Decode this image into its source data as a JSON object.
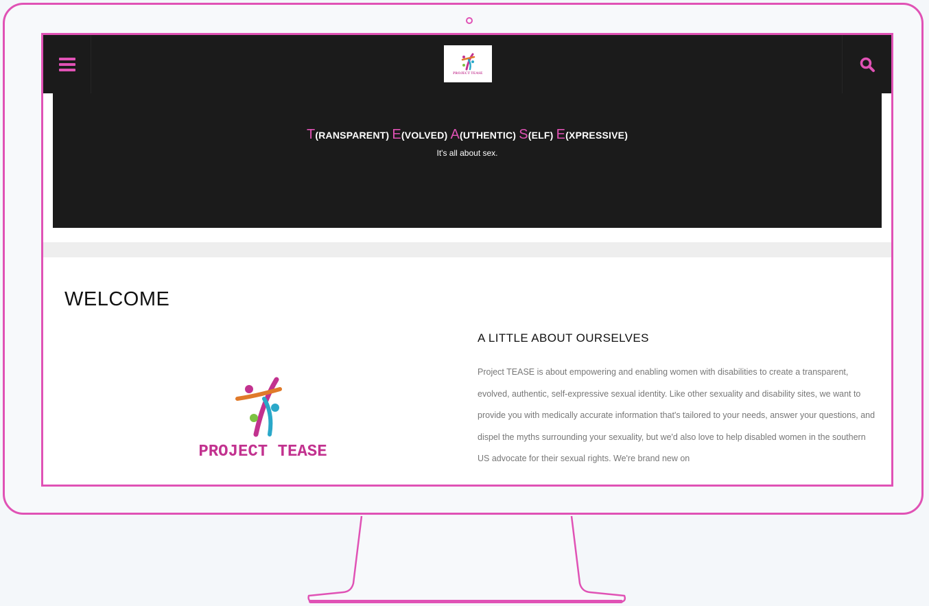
{
  "colors": {
    "accent": "#e052b5",
    "dark": "#1b1b1b",
    "logo_purple": "#c2328f"
  },
  "header": {
    "menu_icon": "hamburger-menu-icon",
    "search_icon": "search-icon",
    "logo_text": "PROJECT TEASE"
  },
  "hero": {
    "title_parts": [
      {
        "cap": "T",
        "rest": "(RANSPARENT)"
      },
      {
        "cap": "E",
        "rest": "(VOLVED)"
      },
      {
        "cap": "A",
        "rest": "(UTHENTIC)"
      },
      {
        "cap": "S",
        "rest": "(ELF)"
      },
      {
        "cap": "E",
        "rest": "(XPRESSIVE)"
      }
    ],
    "subtitle": "It's all about sex."
  },
  "main": {
    "welcome": "WELCOME",
    "logo_text": "PROJECT TEASE",
    "about_heading": "A LITTLE ABOUT OURSELVES",
    "about_body": "Project TEASE is about empowering and enabling women with disabilities to create a transparent, evolved, authentic, self-expressive sexual identity. Like other sexuality and disability sites, we want to provide you with medically accurate information that's tailored to your needs, answer your questions, and dispel the myths surrounding your sexuality, but we'd also love to help disabled women in the southern US advocate for their sexual rights. We're brand new on"
  }
}
